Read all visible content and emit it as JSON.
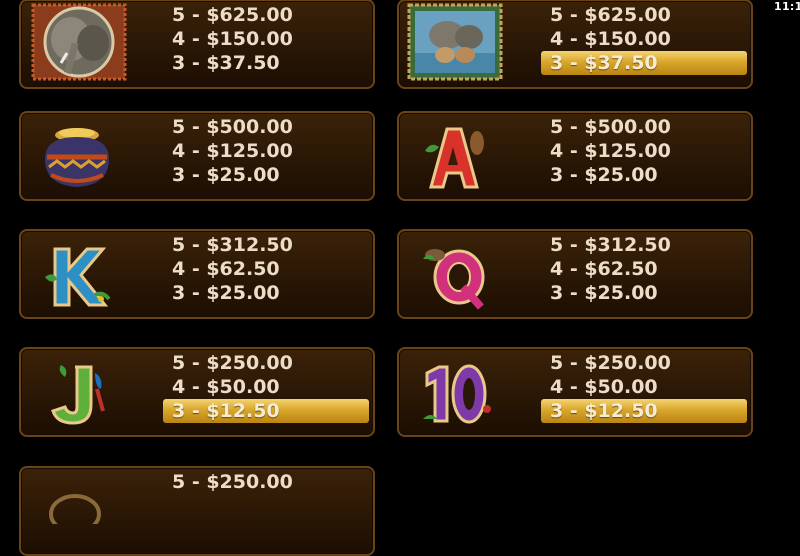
{
  "status": {
    "clock": "11:1"
  },
  "colors": {
    "panel_border": "#6a4419",
    "panel_bg": "#2a1705",
    "text": "#ecdcc8",
    "highlight": "#d9a72b"
  },
  "symbols": [
    {
      "name": "elephant",
      "icon": "elephant-icon",
      "pays": [
        "5 - $625.00",
        "4 - $150.00",
        "3 - $37.50"
      ],
      "highlight": -1
    },
    {
      "name": "elephant-family",
      "icon": "elephant-family-icon",
      "pays": [
        "5 - $625.00",
        "4 - $150.00",
        "3 - $37.50"
      ],
      "highlight": 2
    },
    {
      "name": "pot",
      "icon": "pot-icon",
      "pays": [
        "5 - $500.00",
        "4 - $125.00",
        "3 - $25.00"
      ],
      "highlight": -1
    },
    {
      "name": "ace",
      "icon": "letter-a-icon",
      "pays": [
        "5 - $500.00",
        "4 - $125.00",
        "3 - $25.00"
      ],
      "highlight": -1
    },
    {
      "name": "king",
      "icon": "letter-k-icon",
      "pays": [
        "5 - $312.50",
        "4 - $62.50",
        "3 - $25.00"
      ],
      "highlight": -1
    },
    {
      "name": "queen",
      "icon": "letter-q-icon",
      "pays": [
        "5 - $312.50",
        "4 - $62.50",
        "3 - $25.00"
      ],
      "highlight": -1
    },
    {
      "name": "jack",
      "icon": "letter-j-icon",
      "pays": [
        "5 - $250.00",
        "4 - $50.00",
        "3 - $12.50"
      ],
      "highlight": 2
    },
    {
      "name": "ten",
      "icon": "number-10-icon",
      "pays": [
        "5 - $250.00",
        "4 - $50.00",
        "3 - $12.50"
      ],
      "highlight": 2
    },
    {
      "name": "nine",
      "icon": "number-9-icon",
      "pays": [
        "5 - $250.00"
      ],
      "highlight": -1
    }
  ]
}
